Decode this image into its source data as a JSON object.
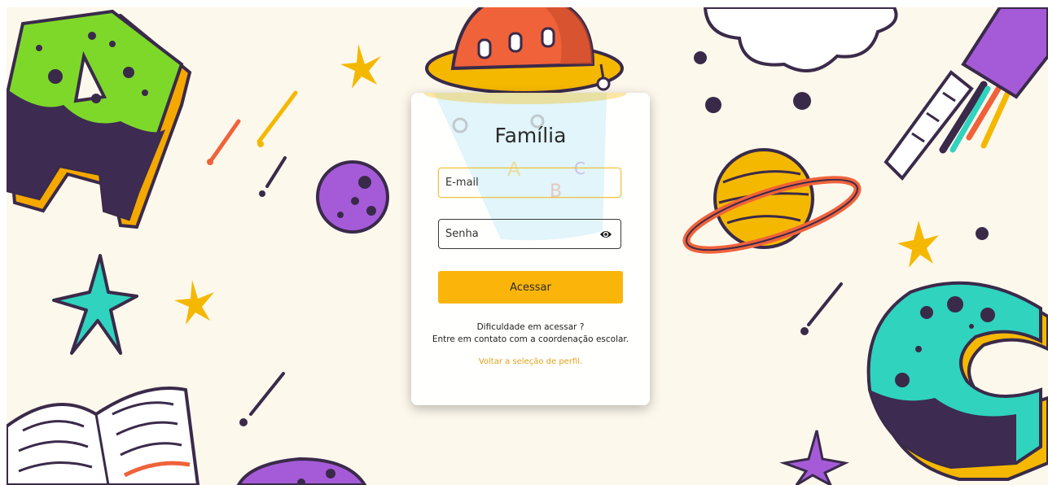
{
  "login": {
    "title": "Família",
    "email_placeholder": "E-mail",
    "password_placeholder": "Senha",
    "submit_label": "Acessar",
    "help_line1": "Dificuldade em acessar ?",
    "help_line2": "Entre em contato com a coordenação escolar.",
    "back_link": "Voltar a seleção de perfil."
  },
  "icons": {
    "password_toggle": "eye-icon"
  },
  "colors": {
    "accent": "#fbb50a",
    "background": "#fdf8ec",
    "link": "#e0a21a",
    "email_focus_border": "#f0c23a"
  }
}
